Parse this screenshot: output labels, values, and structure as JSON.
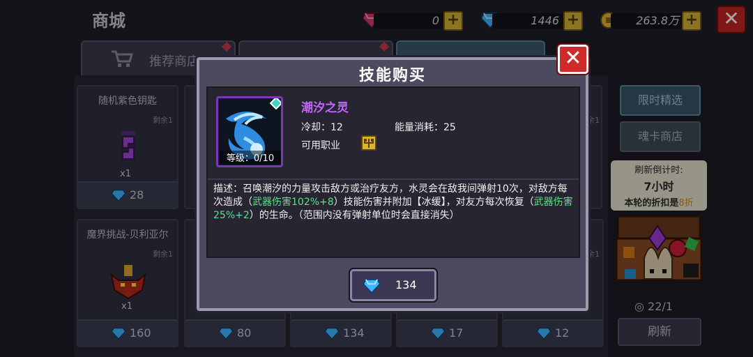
{
  "colors": {
    "accent_gem": "#3fb7ff",
    "skill_name": "#c465ff",
    "highlight": "#5fe08a",
    "close": "#d12a2a"
  },
  "header": {
    "title": "商城",
    "currencies": [
      {
        "icon": "red-gem-icon",
        "value": "0"
      },
      {
        "icon": "blue-gem-icon",
        "value": "1446"
      },
      {
        "icon": "gold-coin-icon",
        "value": "263.8万"
      }
    ]
  },
  "tabs": [
    {
      "label": "推荐商店",
      "icon": "cart-icon"
    },
    {
      "label": "",
      "icon": "shop-icon"
    },
    {
      "label": "",
      "icon": "cart-icon"
    }
  ],
  "cards": [
    {
      "name": "随机紫色钥匙",
      "remain": "剩余1",
      "count": "x1",
      "price": "28"
    },
    {
      "name": "魔界挑战-贝利亚尔",
      "remain": "剩余1",
      "count": "x1",
      "price": "160"
    },
    {
      "price": "80"
    },
    {
      "price": "134"
    },
    {
      "price": "17"
    },
    {
      "price": "12"
    },
    {
      "remain": "余1"
    },
    {
      "remain": "余1"
    }
  ],
  "side": {
    "limited": "限时精选",
    "soul_shop": "魂卡商店",
    "countdown_label": "刷新倒计时:",
    "countdown_value": "7小时",
    "discount_prefix": "本轮的折扣是",
    "discount_value": "8折",
    "count": "22/1",
    "refresh": "刷新"
  },
  "dialog": {
    "title": "技能购买",
    "skill": {
      "name": "潮汐之灵",
      "level": "等级：0/10",
      "cooldown_label": "冷却：",
      "cooldown": "12",
      "energy_label": "能量消耗：",
      "energy": "25",
      "class_label": "可用职业"
    },
    "desc": {
      "p1": "描述：召唤潮汐的力量攻击敌方或治疗友方，水灵会在敌我间弹射10次，对敌方每次造成（",
      "h1": "武器伤害102%+8",
      "p2": "）技能伤害并附加【冰缓】，对友方每次恢复（",
      "h2": "武器伤害25%+2",
      "p3": "）的生命。（范围内没有弹射单位时会直接消失）"
    },
    "price": "134"
  }
}
